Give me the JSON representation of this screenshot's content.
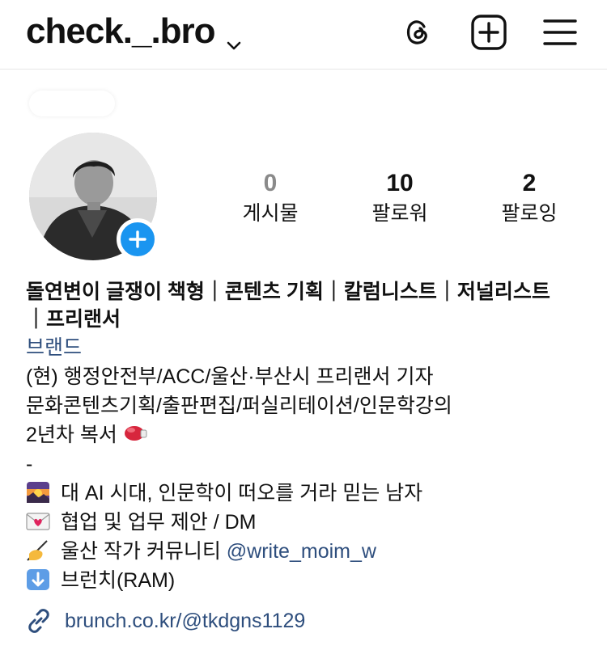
{
  "header": {
    "username": "check._.bro",
    "icons": [
      "chevron-down-icon",
      "threads-icon",
      "create-plus-icon",
      "menu-icon"
    ]
  },
  "profile": {
    "stats": [
      {
        "value": "0",
        "label": "게시물"
      },
      {
        "value": "10",
        "label": "팔로워"
      },
      {
        "value": "2",
        "label": "팔로잉"
      }
    ]
  },
  "bio": {
    "name_line1": "돌연변이 글쟁이 책형｜콘텐츠 기획｜칼럼니스트｜저널리스트",
    "name_line2": "｜프리랜서",
    "category": "브랜드",
    "line1": "(현) 행정안전부/ACC/울산·부산시 프리랜서 기자",
    "line2": "문화콘텐츠기획/출판편집/퍼실리테이션/인문학강의",
    "line3": "2년차 복서",
    "line4": "-",
    "line5": "대 AI 시대, 인문학이 떠오를 거라 믿는 남자",
    "line6": "협업 및 업무 제안 / DM",
    "line7_text": "울산 작가 커뮤니티 ",
    "line7_mention": "@write_moim_w",
    "line8": "브런치(RAM)"
  },
  "link": {
    "url": "brunch.co.kr/@tkdgns1129"
  },
  "colors": {
    "accent": "#1a95f0",
    "link": "#2e4e7d",
    "muted": "#8a8a8a"
  }
}
